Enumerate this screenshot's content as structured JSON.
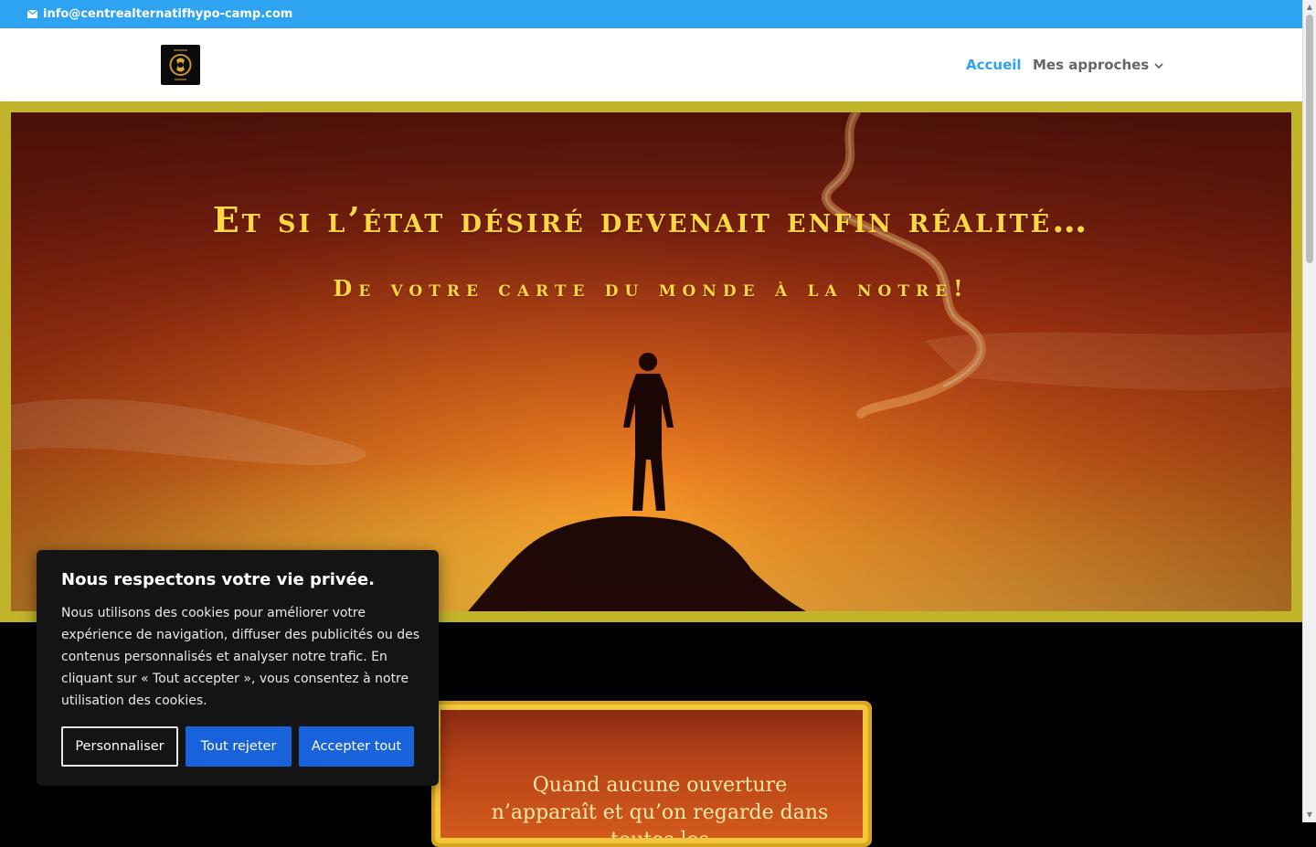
{
  "topbar": {
    "email": "info@centrealternatifhypo-camp.com",
    "email_icon": "envelope-icon",
    "color": "#2ea3f2"
  },
  "header": {
    "logo_icon": "site-logo",
    "nav": [
      {
        "label": "Accueil",
        "active": true
      },
      {
        "label": "Mes approches",
        "has_dropdown": true
      }
    ],
    "accent": "#2ea3f2"
  },
  "hero": {
    "title": "Et si l’état désiré devenait enfin réalité…",
    "subtitle": "De votre carte du monde à la notre!",
    "frame_color": "#c2b42a",
    "text_color": "#ffd743"
  },
  "quote": {
    "text": "Quand aucune ouverture n’apparaît et qu’on regarde dans toutes les"
  },
  "cookie": {
    "title": "Nous respectons votre vie privée.",
    "body": "Nous utilisons des cookies pour améliorer votre expérience de navigation, diffuser des publicités ou des contenus personnalisés et analyser notre trafic. En cliquant sur « Tout accepter », vous consentez à notre utilisation des cookies.",
    "customize_label": "Personnaliser",
    "reject_label": "Tout rejeter",
    "accept_label": "Accepter tout",
    "button_color": "#1863dc"
  }
}
